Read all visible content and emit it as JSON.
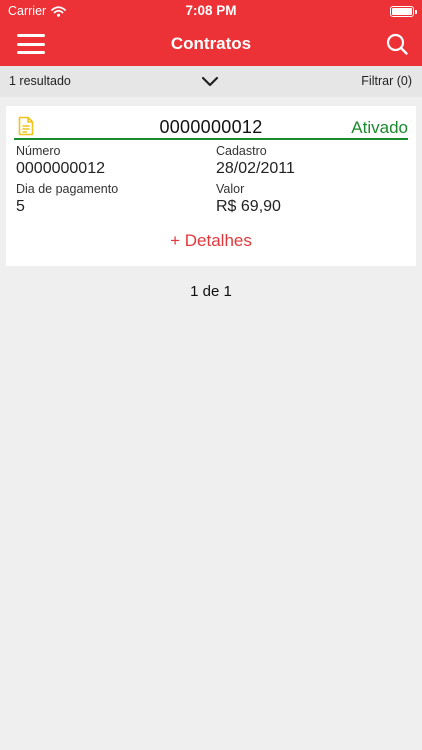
{
  "status_bar": {
    "carrier": "Carrier",
    "time": "7:08 PM"
  },
  "header": {
    "title": "Contratos"
  },
  "filter_bar": {
    "result_count": "1 resultado",
    "filter_label": "Filtrar (0)"
  },
  "card": {
    "number": "0000000012",
    "status": "Ativado",
    "fields": {
      "numero_label": "Número",
      "numero_value": "0000000012",
      "cadastro_label": "Cadastro",
      "cadastro_value": "28/02/2011",
      "dia_label": "Dia de pagamento",
      "dia_value": "5",
      "valor_label": "Valor",
      "valor_value": "R$ 69,90"
    },
    "details_link": "+ Detalhes"
  },
  "pagination": {
    "text": "1 de 1"
  },
  "colors": {
    "brand_red": "#ec3237",
    "status_green": "#1b8a2c",
    "doc_icon_yellow": "#f0c419"
  }
}
